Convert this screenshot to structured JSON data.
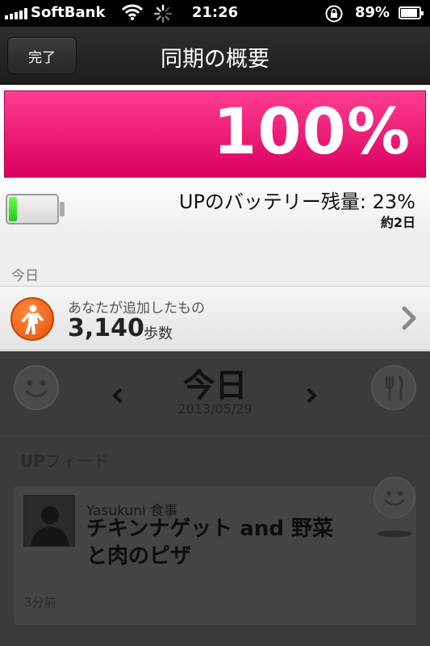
{
  "status_bar": {
    "carrier": "SoftBank",
    "time": "21:26",
    "battery_percent": "89%",
    "battery_level": 0.89
  },
  "nav": {
    "done_label": "完了",
    "title": "同期の概要"
  },
  "sync": {
    "progress_text": "100%",
    "progress_value": 1.0,
    "band_battery_label": "UPのバッテリー残量: 23%",
    "band_battery_level": 0.23,
    "band_battery_days": "約2日",
    "colors": {
      "progress": "#e6006f",
      "battery_fill": "#22c91a"
    }
  },
  "today": {
    "section_header": "今日",
    "added_label": "あなたが追加したもの",
    "added_value": "3,140",
    "added_unit": "歩数"
  },
  "background": {
    "day_title": "今日",
    "date": "2013/05/29",
    "feed_header_bold": "UP",
    "feed_header_rest": "フィード",
    "card": {
      "user_line": "Yasukuni 食事",
      "text": "チキンナゲット and 野菜と肉のピザ",
      "time": "3分前"
    }
  }
}
